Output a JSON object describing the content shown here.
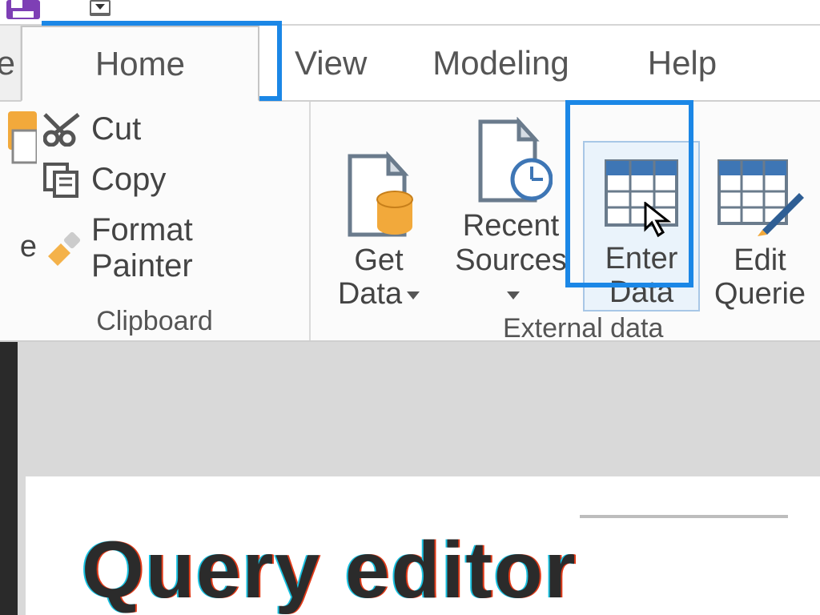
{
  "tabs": {
    "file_suffix": "e",
    "home": "Home",
    "view": "View",
    "modeling": "Modeling",
    "help": "Help"
  },
  "clipboard": {
    "paste_suffix": "e",
    "cut": "Cut",
    "copy": "Copy",
    "format_painter": "Format Painter",
    "group_label": "Clipboard"
  },
  "external": {
    "get_data_l1": "Get",
    "get_data_l2": "Data",
    "recent_l1": "Recent",
    "recent_l2": "Sources",
    "enter_l1": "Enter",
    "enter_l2": "Data",
    "edit_l1": "Edit",
    "edit_l2": "Querie",
    "group_label": "External data"
  },
  "document": {
    "title": "Query editor"
  },
  "icons": {
    "save": "save-icon",
    "qat_dropdown": "qat-dropdown-icon",
    "scissors": "scissors-icon",
    "copy": "copy-icon",
    "brush": "brush-icon",
    "page_db": "page-db-icon",
    "page_clock": "page-clock-icon",
    "table": "table-icon",
    "table_pen": "table-pen-icon",
    "cursor": "cursor-icon"
  },
  "colors": {
    "highlight": "#1b87e6",
    "accent_save": "#7e3fb5",
    "db_orange": "#f2a93b",
    "table_blue": "#3e76b5",
    "brush": "#f4b24a"
  }
}
